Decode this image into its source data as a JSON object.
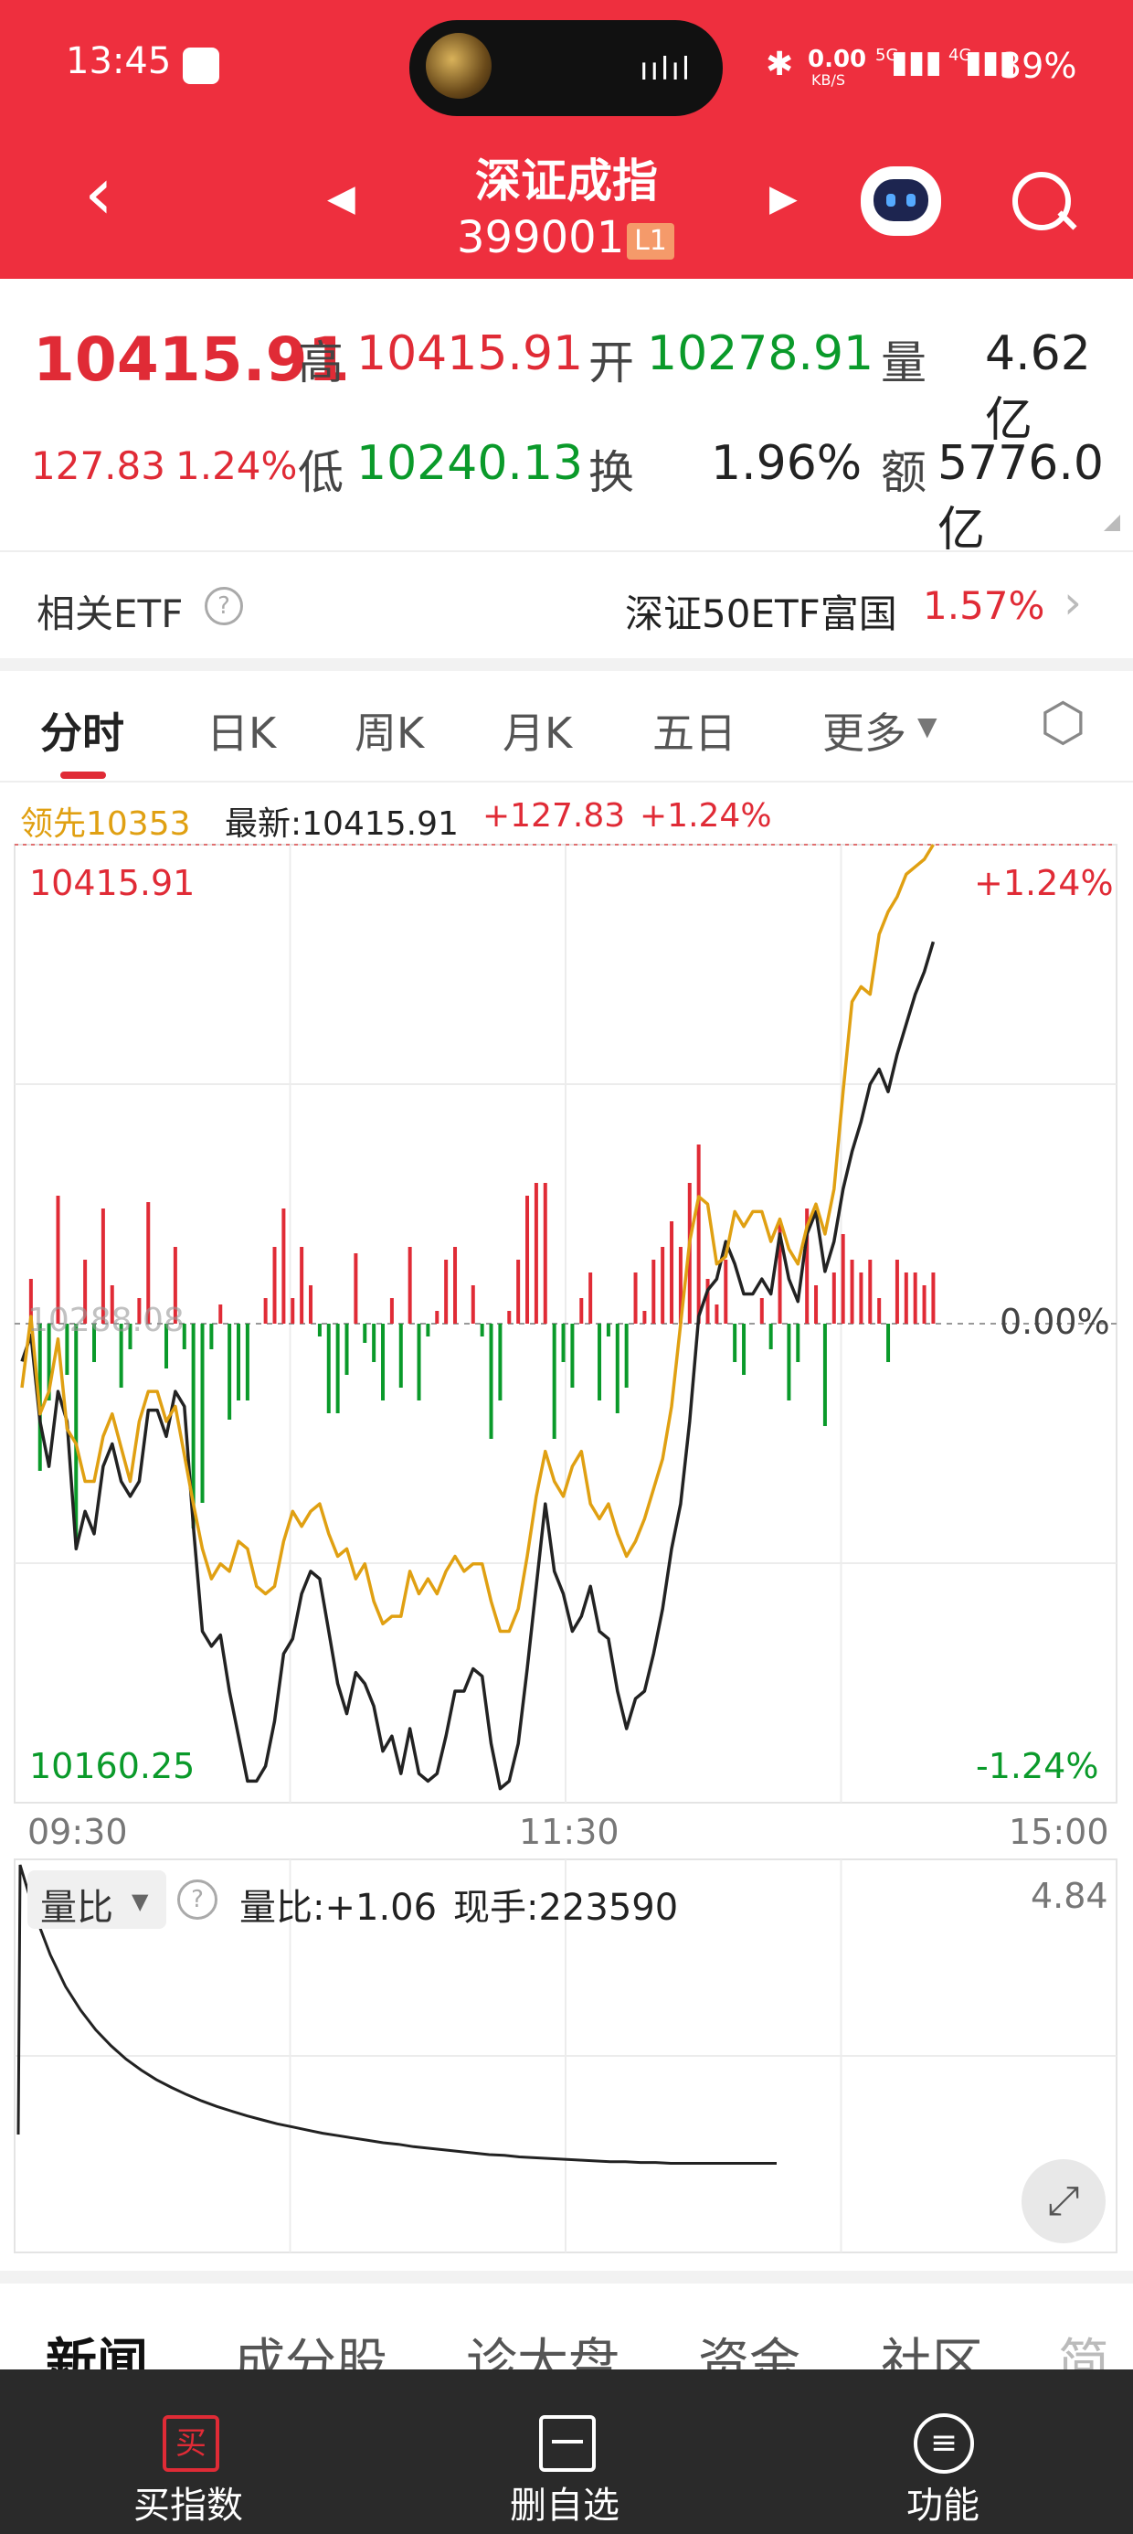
{
  "status_bar": {
    "time": "13:45",
    "net_speed_value": "0.00",
    "net_speed_unit": "KB/S",
    "signal_5g": "5G",
    "signal_4g": "4G",
    "battery": "39%"
  },
  "header": {
    "title": "深证成指",
    "code": "399001",
    "level_badge": "L1"
  },
  "quote": {
    "price": "10415.91",
    "change": "127.83",
    "change_pct": "1.24%",
    "high_label": "高",
    "high": "10415.91",
    "low_label": "低",
    "low": "10240.13",
    "open_label": "开",
    "open": "10278.91",
    "turnover_label": "换",
    "turnover": "1.96%",
    "volume_label": "量",
    "volume": "4.62亿",
    "amount_label": "额",
    "amount": "5776.0亿"
  },
  "etf": {
    "label": "相关ETF",
    "name": "深证50ETF富国",
    "pct": "1.57%"
  },
  "tabs": [
    "分时",
    "日K",
    "周K",
    "月K",
    "五日",
    "更多"
  ],
  "chart_info": {
    "leader": "领先10353",
    "latest": "最新:10415.91",
    "change": "+127.83",
    "pct": "+1.24%"
  },
  "chart_data": [
    {
      "type": "line",
      "ylim": [
        10160.25,
        10415.91
      ],
      "ref_price": 10288.08,
      "y_top_label": "10415.91",
      "y_bottom_label": "10160.25",
      "y_mid_label": "10288.08",
      "right_top_label": "+1.24%",
      "right_mid_label": "0.00%",
      "right_bottom_label": "-1.24%",
      "x_ticks": [
        "09:30",
        "11:30",
        "15:00"
      ],
      "series": [
        {
          "values": [
            10278,
            10285,
            10262,
            10250,
            10270,
            10262,
            10228,
            10238,
            10232,
            10250,
            10256,
            10246,
            10242,
            10246,
            10265,
            10265,
            10258,
            10270,
            10266,
            10234,
            10206,
            10202,
            10205,
            10190,
            10178,
            10166,
            10166,
            10170,
            10182,
            10200,
            10204,
            10216,
            10222,
            10220,
            10206,
            10192,
            10184,
            10195,
            10192,
            10186,
            10174,
            10178,
            10168,
            10180,
            10168,
            10166,
            10168,
            10178,
            10190,
            10190,
            10196,
            10194,
            10176,
            10164,
            10166,
            10176,
            10196,
            10218,
            10240,
            10222,
            10216,
            10206,
            10210,
            10218,
            10206,
            10204,
            10190,
            10180,
            10188,
            10190,
            10200,
            10212,
            10228,
            10240,
            10262,
            10290,
            10297,
            10300,
            10310,
            10304,
            10296,
            10296,
            10300,
            10296,
            10312,
            10300,
            10294,
            10312,
            10318,
            10302,
            10310,
            10324,
            10334,
            10342,
            10352,
            10356,
            10350,
            10360,
            10368,
            10376,
            10382,
            10390
          ]
        },
        {
          "values": [
            10271,
            10290,
            10264,
            10270,
            10284,
            10260,
            10256,
            10246,
            10246,
            10258,
            10264,
            10255,
            10246,
            10262,
            10270,
            10270,
            10262,
            10266,
            10253,
            10240,
            10228,
            10220,
            10224,
            10222,
            10230,
            10228,
            10218,
            10216,
            10218,
            10230,
            10238,
            10234,
            10238,
            10240,
            10232,
            10226,
            10228,
            10220,
            10224,
            10214,
            10208,
            10210,
            10210,
            10222,
            10216,
            10220,
            10216,
            10222,
            10226,
            10222,
            10224,
            10224,
            10214,
            10206,
            10206,
            10212,
            10226,
            10242,
            10254,
            10246,
            10242,
            10250,
            10254,
            10240,
            10236,
            10240,
            10232,
            10226,
            10230,
            10236,
            10244,
            10252,
            10266,
            10288,
            10310,
            10322,
            10320,
            10304,
            10306,
            10318,
            10314,
            10318,
            10318,
            10310,
            10316,
            10308,
            10304,
            10314,
            10320,
            10312,
            10324,
            10350,
            10374,
            10378,
            10376,
            10392,
            10398,
            10402,
            10408,
            10410,
            10412,
            10415.91
          ]
        }
      ]
    },
    {
      "type": "line",
      "title": "量比",
      "readout": "量比:+1.06",
      "hand_label": "现手:223590",
      "max_label": "4.84",
      "ylim": [
        0,
        4.84
      ],
      "series": [
        {
          "values": [
            4.84,
            4.2,
            3.7,
            3.3,
            3.0,
            2.75,
            2.55,
            2.38,
            2.24,
            2.12,
            2.02,
            1.93,
            1.85,
            1.78,
            1.72,
            1.66,
            1.61,
            1.56,
            1.52,
            1.48,
            1.44,
            1.41,
            1.38,
            1.35,
            1.32,
            1.3,
            1.27,
            1.25,
            1.23,
            1.21,
            1.19,
            1.17,
            1.16,
            1.14,
            1.13,
            1.12,
            1.11,
            1.1,
            1.09,
            1.08,
            1.08,
            1.07,
            1.07,
            1.06,
            1.06,
            1.06,
            1.06,
            1.06,
            1.06,
            1.06,
            1.06
          ]
        }
      ]
    }
  ],
  "news_tabs": [
    "新闻",
    "成分股",
    "诊大盘",
    "资金",
    "社区",
    "简况"
  ],
  "bottom_nav": [
    {
      "label": "买指数",
      "icon_char": "买"
    },
    {
      "label": "删自选"
    },
    {
      "label": "功能"
    }
  ],
  "colors": {
    "brand_red": "#ee2f3e",
    "up": "#e02b36",
    "down": "#0a9a2a",
    "leader": "#e0a012"
  }
}
